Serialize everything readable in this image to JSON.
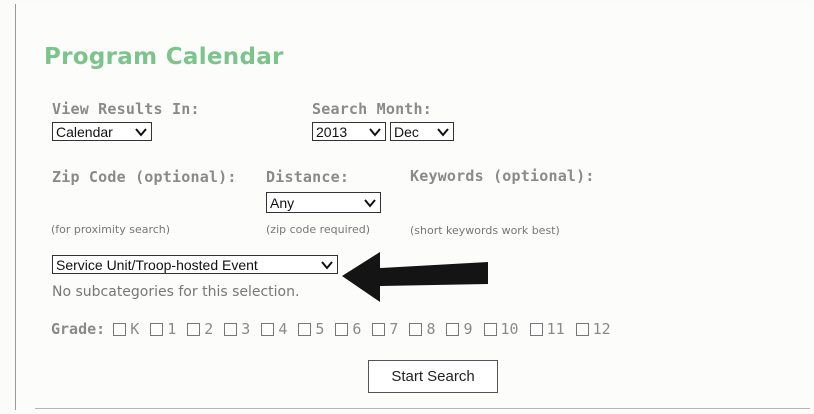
{
  "title": "Program Calendar",
  "view_results": {
    "label": "View Results In:",
    "value": "Calendar"
  },
  "search_month": {
    "label": "Search Month:",
    "year": "2013",
    "month": "Dec"
  },
  "zip_code": {
    "label": "Zip Code (optional):",
    "hint": "(for proximity search)"
  },
  "distance": {
    "label": "Distance:",
    "value": "Any",
    "hint": "(zip code required)"
  },
  "keywords": {
    "label": "Keywords (optional):",
    "hint": "(short keywords work best)"
  },
  "category": {
    "value": "Service Unit/Troop-hosted Event",
    "note": "No subcategories for this selection."
  },
  "grade": {
    "label": "Grade:",
    "options": [
      "K",
      "1",
      "2",
      "3",
      "4",
      "5",
      "6",
      "7",
      "8",
      "9",
      "10",
      "11",
      "12"
    ]
  },
  "submit_label": "Start Search",
  "icons": {
    "dropdown": "chevron-down-icon",
    "annotation": "arrow-left-icon"
  }
}
